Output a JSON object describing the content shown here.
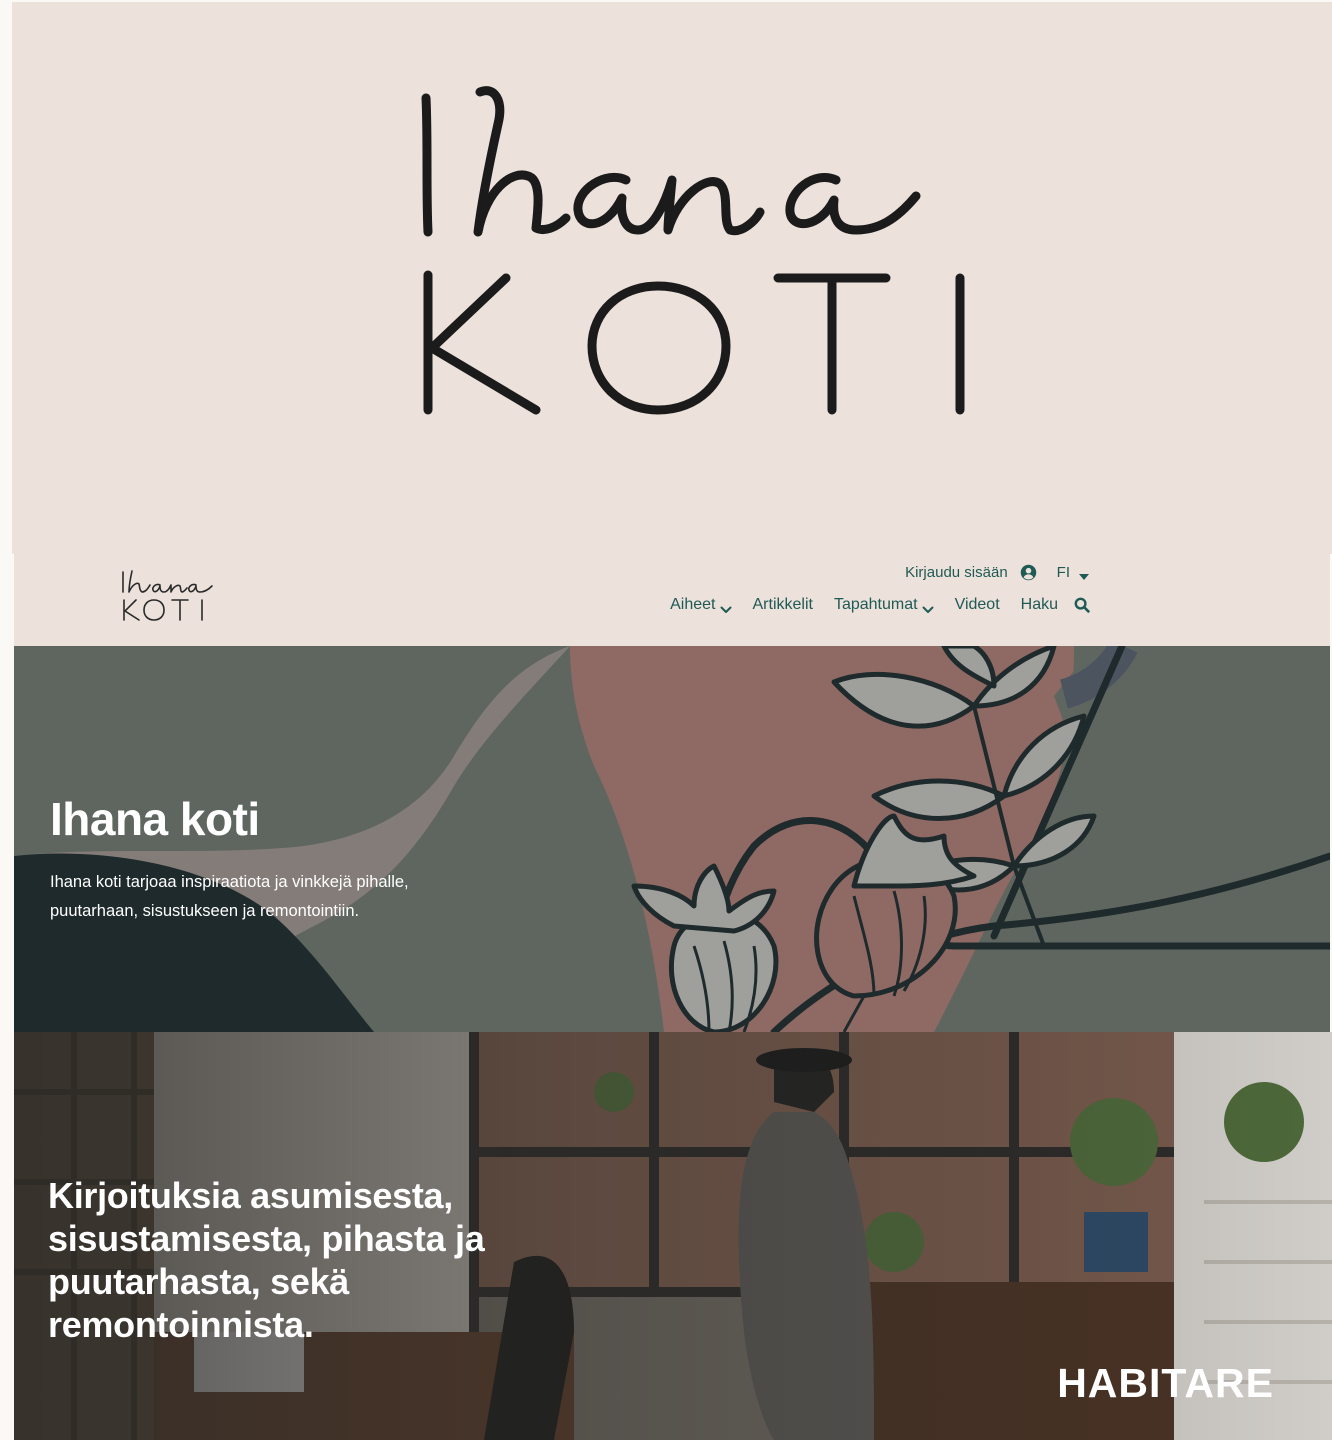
{
  "brand": {
    "logo_script": "Ihana",
    "logo_caps": "KOTI"
  },
  "nav": {
    "login_label": "Kirjaudu sisään",
    "language": "FI",
    "items": [
      {
        "label": "Aiheet",
        "has_dropdown": true
      },
      {
        "label": "Artikkelit",
        "has_dropdown": false
      },
      {
        "label": "Tapahtumat",
        "has_dropdown": true
      },
      {
        "label": "Videot",
        "has_dropdown": false
      },
      {
        "label": "Haku",
        "has_dropdown": false
      }
    ],
    "icons": [
      "user-icon",
      "caret-down-icon",
      "chevron-down-icon",
      "search-icon"
    ]
  },
  "hero": {
    "title": "Ihana koti",
    "text": "Ihana koti tarjoaa inspiraatiota ja vinkkejä pihalle, puutarhaan, sisustukseen ja remontointiin."
  },
  "feature": {
    "heading": "Kirjoituksia asumisesta, sisustamisesta, pihasta ja puutarhasta, sekä remontoinnista.",
    "partner": "HABITARE"
  },
  "colors": {
    "background": "#ede1dc",
    "nav_text": "#1f5a54",
    "hero_green": "#5e665f",
    "hero_dark": "#1f2a2c",
    "hero_pink": "#8f6a64",
    "hero_taupe": "#847c78",
    "white": "#ffffff"
  }
}
